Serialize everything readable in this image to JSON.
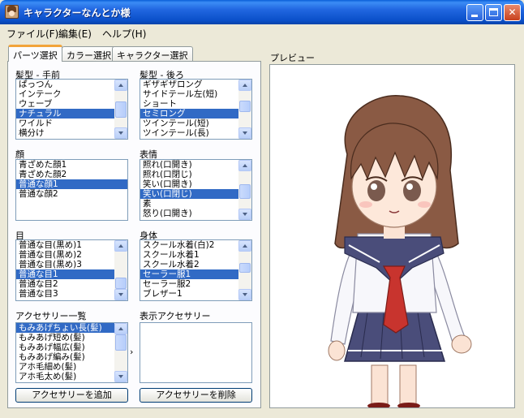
{
  "window": {
    "title": "キャラクターなんとか様",
    "min_label": "",
    "max_label": "",
    "close_label": "✕"
  },
  "menu": {
    "items": [
      {
        "label": "ファイル(F)"
      },
      {
        "label": "編集(E)"
      },
      {
        "label": "ヘルプ(H)"
      }
    ]
  },
  "tabs": [
    {
      "label": "パーツ選択",
      "active": true
    },
    {
      "label": "カラー選択",
      "active": false
    },
    {
      "label": "キャラクター選択",
      "active": false
    }
  ],
  "parts": {
    "hair_front": {
      "label": "髪型 - 手前",
      "items": [
        "ぱっつん",
        "インテーク",
        "ウェーブ",
        "ナチュラル",
        "ワイルド",
        "横分け"
      ],
      "selected": 3
    },
    "hair_back": {
      "label": "髪型 - 後ろ",
      "items": [
        "ギザギザロング",
        "サイドテール左(短)",
        "ショート",
        "セミロング",
        "ツインテール(短)",
        "ツインテール(長)"
      ],
      "selected": 3
    },
    "face": {
      "label": "顔",
      "items": [
        "青ざめた顔1",
        "青ざめた顔2",
        "普通な顔1",
        "普通な顔2"
      ],
      "selected": 2
    },
    "expression": {
      "label": "表情",
      "items": [
        "照れ(口開き)",
        "照れ(口閉じ)",
        "笑い(口開き)",
        "笑い(口閉じ)",
        "素",
        "怒り(口開き)"
      ],
      "selected": 3
    },
    "eyes": {
      "label": "目",
      "items": [
        "普通な目(黒め)1",
        "普通な目(黒め)2",
        "普通な目(黒め)3",
        "普通な目1",
        "普通な目2",
        "普通な目3"
      ],
      "selected": 3
    },
    "body": {
      "label": "身体",
      "items": [
        "スクール水着(白)2",
        "スクール水着1",
        "スクール水着2",
        "セーラー服1",
        "セーラー服2",
        "ブレザー1"
      ],
      "selected": 3
    },
    "accessory_list": {
      "label": "アクセサリー一覧",
      "items": [
        "もみあげちょい長(髪)",
        "もみあげ短め(髪)",
        "もみあげ幅広(髪)",
        "もみあげ編み(髪)",
        "アホ毛細め(髪)",
        "アホ毛太め(髪)"
      ],
      "selected": 0
    },
    "displayed_accessories": {
      "label": "表示アクセサリー",
      "items": []
    },
    "move_arrow": "›",
    "add_button": "アクセサリーを追加",
    "remove_button": "アクセサリーを削除"
  },
  "preview": {
    "label": "プレビュー"
  },
  "colors": {
    "selection": "#316ac5",
    "title_bar": "#0a4fc8",
    "uniform_navy": "#4a4d7a",
    "ribbon_red": "#c8342e",
    "hair_brown": "#8a5a44"
  }
}
